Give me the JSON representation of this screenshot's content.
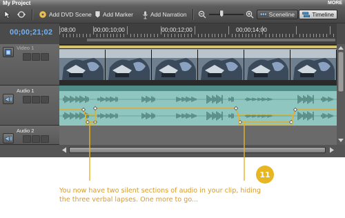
{
  "window": {
    "title": "My Project",
    "more_label": "MORE"
  },
  "toolbar": {
    "add_dvd_scene": "Add DVD Scene",
    "add_marker": "Add Marker",
    "add_narration": "Add Narration",
    "zoom_level": 0.35,
    "sceneline": "Sceneline",
    "timeline": "Timeline",
    "active_view": "Timeline"
  },
  "timeline": {
    "current_timecode": "00;00;21;02",
    "ruler_labels": [
      ";08;00",
      "00;00;10;00",
      "00;00;12;00",
      "00;00;14;00"
    ]
  },
  "tracks": {
    "video_label": "Video 1",
    "audio1_label": "Audio 1",
    "audio2_label": "Audio 2"
  },
  "annotation": {
    "caption_line1": "You now have two silent sections of audio in your clip, hiding",
    "caption_line2": "the three verbal lapses. One more to go...",
    "step_number": "11"
  },
  "colors": {
    "accent_blue": "#6ab4ff",
    "audio_clip": "#8fc6c0",
    "rubberband": "#e8a92a",
    "annotation": "#d79a2a"
  }
}
